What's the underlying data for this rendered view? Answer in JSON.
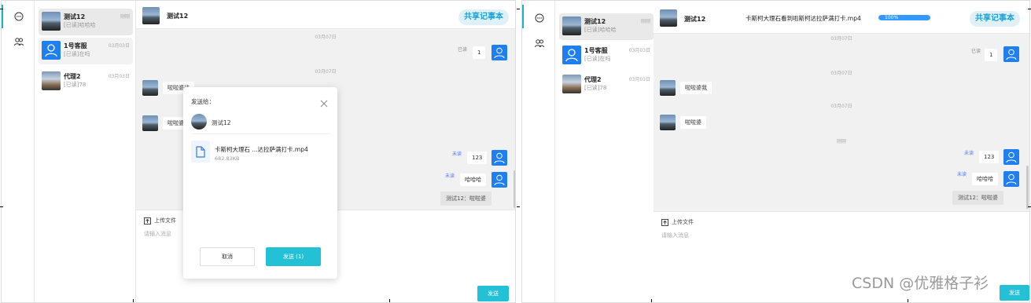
{
  "left": {
    "contacts": [
      {
        "name": "测试12",
        "msg": "[已读]哈哈哈",
        "date": "刚刚"
      },
      {
        "name": "1号客服",
        "msg": "[已读]在吗",
        "date": "03月03日"
      },
      {
        "name": "代理2",
        "msg": "[已读]78",
        "date": "03月03日"
      }
    ],
    "header": {
      "title": "测试12",
      "share": "共享记事本"
    },
    "messages": {
      "ts1": "03月07日",
      "read": "已读",
      "num1": "1",
      "ts2": "03月07日",
      "recv1": "啦啦婆娑",
      "recv2": "啦啦婆",
      "unread": "未读",
      "num2": "123",
      "haha": "哈哈哈",
      "quote": "测试12：啦啦婆"
    },
    "input": {
      "upload": "上传文件",
      "placeholder": "请输入消息",
      "send": "发送"
    },
    "modal": {
      "title": "发送给：",
      "recipient": "测试12",
      "file_name": "卡斯柯大理石 ...达拉萨满打卡.mp4",
      "file_size": "682.83KB",
      "cancel": "取消",
      "send": "发送 (1)"
    }
  },
  "right": {
    "contacts": [
      {
        "name": "测试12",
        "msg": "[已读]哈哈哈",
        "date": "刚刚"
      },
      {
        "name": "1号客服",
        "msg": "[已读]在吗",
        "date": "03月03日"
      },
      {
        "name": "代理2",
        "msg": "[已读]78",
        "date": "03月03日"
      }
    ],
    "header": {
      "title": "测试12",
      "share": "共享记事本",
      "uploading_file": "卡斯柯大理石看到啦斯柯达拉萨满打卡.mp4",
      "progress_label": "100%",
      "progress": 1.0
    },
    "messages": {
      "ts1": "03月07日",
      "read": "已读",
      "num1": "1",
      "ts2": "03月07日",
      "recv1": "啦啦婆我",
      "ts3": "03月07日",
      "recv2": "啦啦婆",
      "ts4": "刚刚",
      "unread": "未读",
      "num2": "123",
      "haha": "哈哈哈",
      "quote": "测试12：啦啦婆"
    },
    "input": {
      "upload": "上传文件",
      "placeholder": "请输入消息",
      "send": "发送"
    }
  },
  "watermark": "CSDN @优雅格子衫",
  "colors": {
    "accent": "#23c0d6",
    "user_avatar": "#1f7ff0",
    "progress": "#3399ff"
  }
}
